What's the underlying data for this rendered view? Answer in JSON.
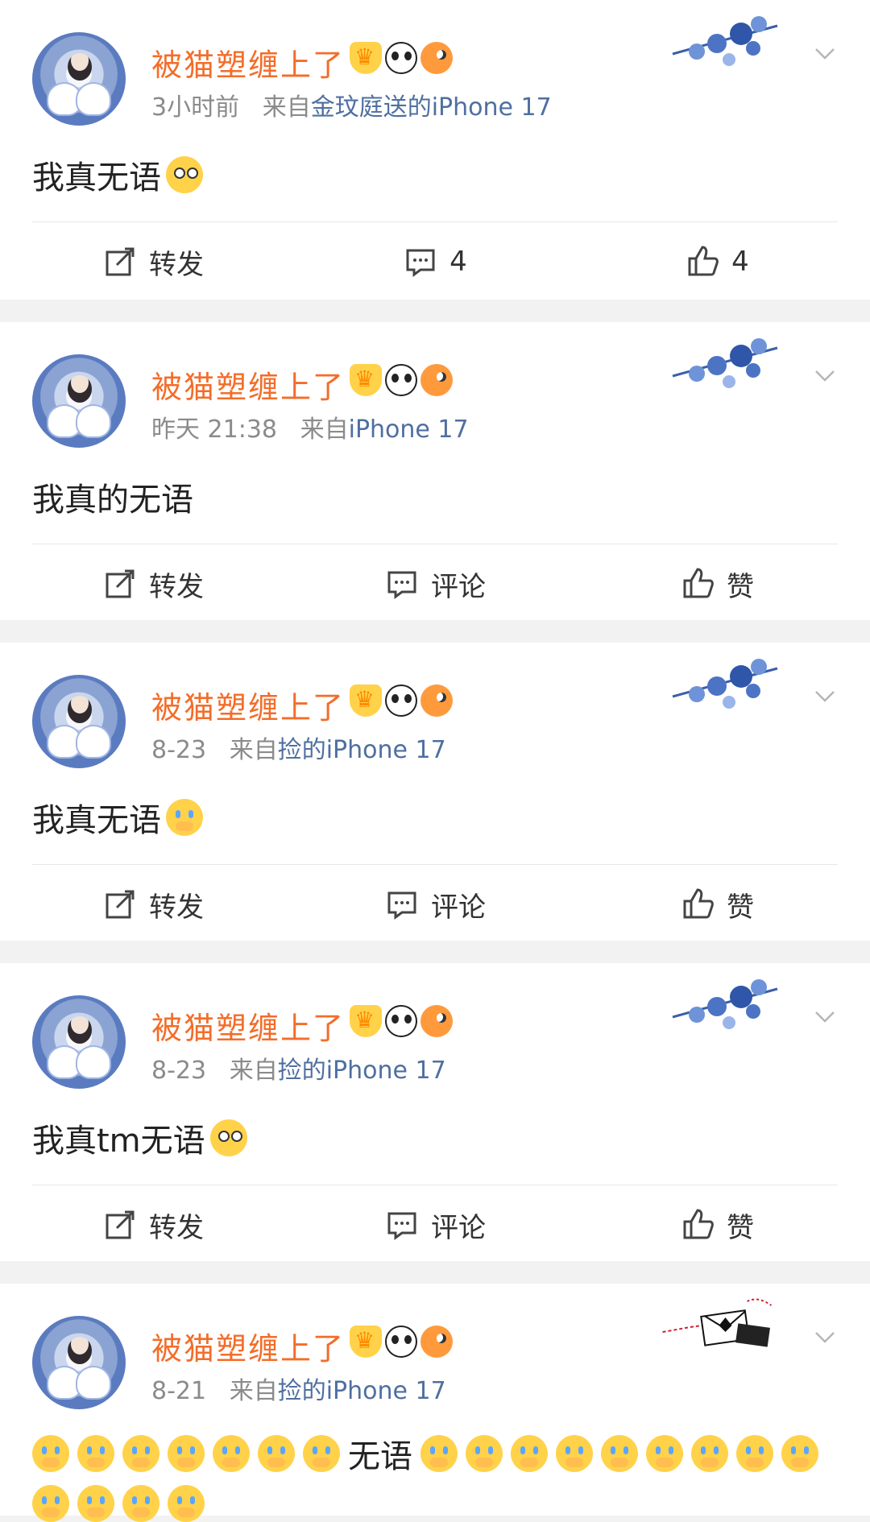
{
  "posts": [
    {
      "username": "被猫塑缠上了",
      "time": "3小时前",
      "source_prefix": "来自",
      "source": "金玟庭送的iPhone 17",
      "text": "我真无语",
      "emoji": "roll-eyes-emoji",
      "actions": {
        "repost": "转发",
        "comment": "4",
        "like": "4"
      }
    },
    {
      "username": "被猫塑缠上了",
      "time": "昨天 21:38",
      "source_prefix": "来自",
      "source": "iPhone 17",
      "text": "我真的无语",
      "emoji": "",
      "actions": {
        "repost": "转发",
        "comment": "评论",
        "like": "赞"
      }
    },
    {
      "username": "被猫塑缠上了",
      "time": "8-23",
      "source_prefix": "来自",
      "source": "捡的iPhone 17",
      "text": "我真无语",
      "emoji": "crying-emoji",
      "actions": {
        "repost": "转发",
        "comment": "评论",
        "like": "赞"
      }
    },
    {
      "username": "被猫塑缠上了",
      "time": "8-23",
      "source_prefix": "来自",
      "source": "捡的iPhone 17",
      "text": "我真tm无语",
      "emoji": "roll-eyes-emoji",
      "actions": {
        "repost": "转发",
        "comment": "评论",
        "like": "赞"
      }
    },
    {
      "username": "被猫塑缠上了",
      "time": "8-21",
      "source_prefix": "来自",
      "source": "捡的iPhone 17",
      "text": "无语",
      "emoji": "crying-emoji",
      "emoji_before_count": 7,
      "emoji_after_count": 13
    }
  ],
  "colors": {
    "username": "#f36d2a",
    "meta": "#8b8b8b",
    "source": "#4f6fa0",
    "bg": "#f2f2f2"
  },
  "icons": [
    "crown-badge-icon",
    "panda-badge-icon",
    "fish-badge-icon",
    "repost-icon",
    "comment-icon",
    "like-icon",
    "chevron-down-icon",
    "blue-flower-decoration-icon",
    "envelope-decoration-icon"
  ]
}
